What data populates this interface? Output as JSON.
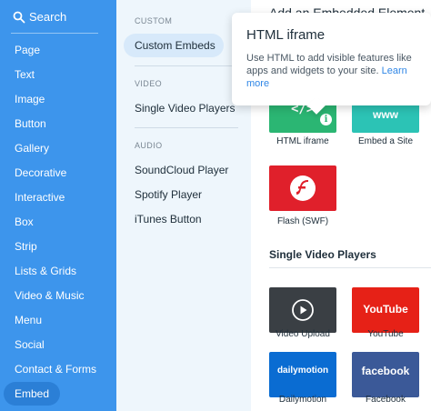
{
  "sidebar": {
    "search_label": "Search",
    "items": [
      "Page",
      "Text",
      "Image",
      "Button",
      "Gallery",
      "Decorative",
      "Interactive",
      "Box",
      "Strip",
      "Lists & Grids",
      "Video & Music",
      "Menu",
      "Social",
      "Contact & Forms",
      "Embed"
    ],
    "active_item": "Embed"
  },
  "categories": {
    "custom_header": "CUSTOM",
    "custom_embeds": "Custom Embeds",
    "video_header": "VIDEO",
    "single_video_players": "Single Video Players",
    "audio_header": "AUDIO",
    "soundcloud": "SoundCloud Player",
    "spotify": "Spotify Player",
    "itunes": "iTunes Button"
  },
  "content": {
    "top_header": "Add an Embedded Element",
    "embeds": [
      {
        "label": "HTML iframe",
        "color": "#2bb673"
      },
      {
        "label": "Embed a Site",
        "color": "#2cc3b5",
        "tile_text": "www"
      },
      {
        "label": "Flash (SWF)",
        "color": "#e0202b"
      }
    ],
    "single_video_title": "Single Video Players",
    "videos": [
      {
        "label": "Video Upload",
        "color": "#3a3f44"
      },
      {
        "label": "YouTube",
        "color": "#e62117",
        "tile_text": "YouTube"
      },
      {
        "label": "Dailymotion",
        "color": "#0a6cd2",
        "tile_text": "dailymotion"
      },
      {
        "label": "Facebook",
        "color": "#3b5998",
        "tile_text": "facebook"
      }
    ]
  },
  "tooltip": {
    "title": "HTML iframe",
    "body": "Use HTML to add visible features like apps and widgets to your site.",
    "link": "Learn more"
  },
  "colors": {
    "sidebar_bg": "#3d95ec",
    "panel_bg": "#eef6fc",
    "accent_link": "#2f86e6"
  }
}
